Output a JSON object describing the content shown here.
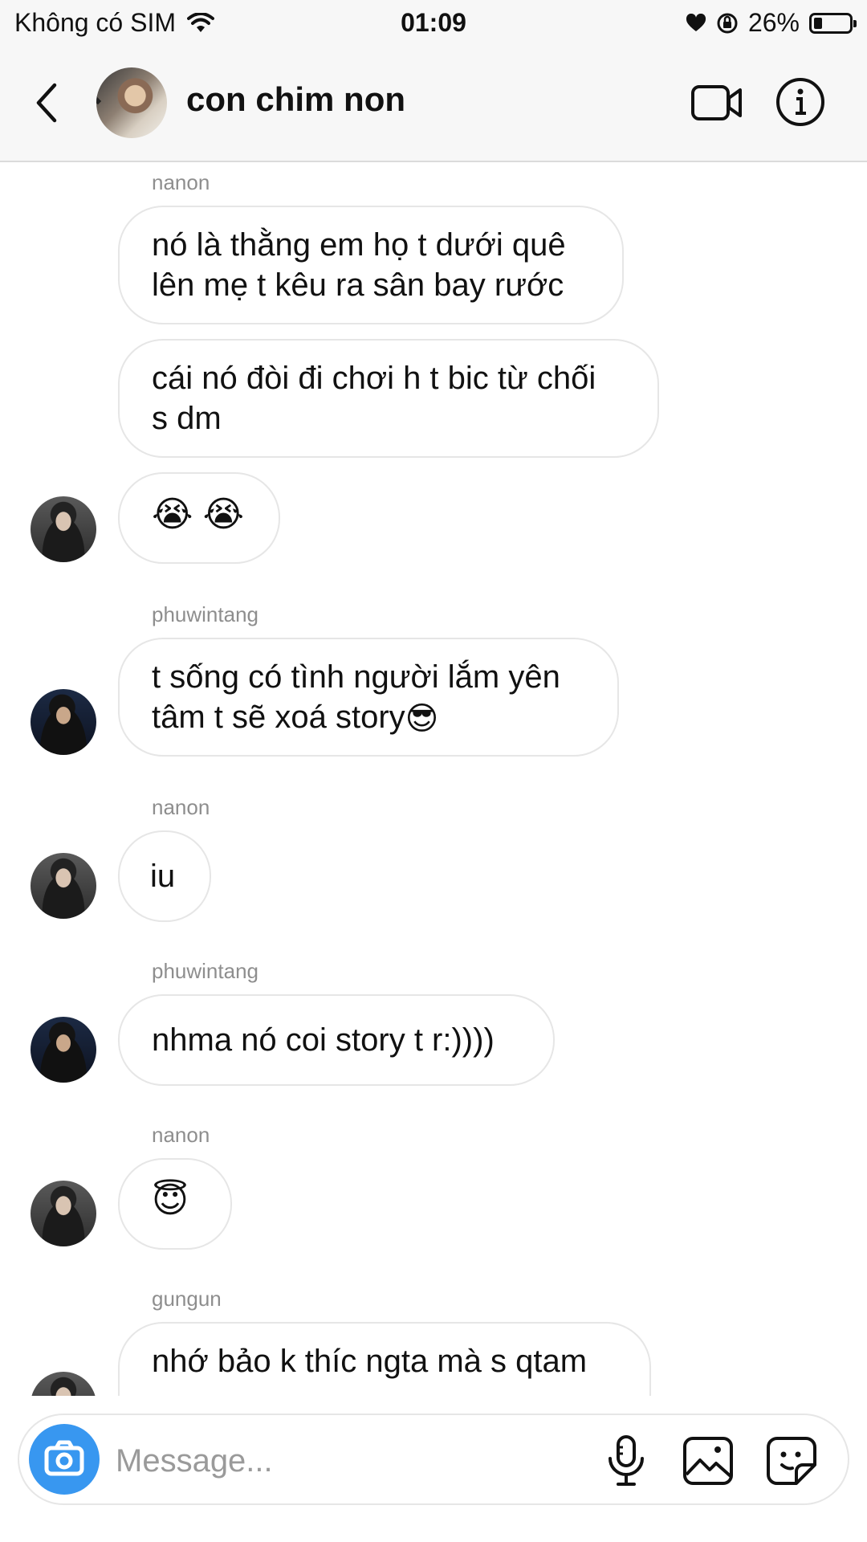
{
  "status_bar": {
    "carrier": "Không có SIM",
    "time": "01:09",
    "battery_percent": "26%"
  },
  "header": {
    "title": "con chim non"
  },
  "messages": [
    {
      "sender": "nanon",
      "lines": [
        "nó là thằng em họ t dưới quê",
        "lên mẹ t kêu ra sân bay rước"
      ]
    },
    {
      "lines": [
        "cái nó đòi đi chơi h t bic từ chối",
        "s dm"
      ]
    },
    {
      "emoji": [
        "😭",
        "😭"
      ]
    },
    {
      "sender": "phuwintang",
      "lines": [
        "t sống có tình người lắm yên",
        "tâm t sẽ xoá story"
      ],
      "trailing_emoji": "😎"
    },
    {
      "sender": "nanon",
      "text": "iu"
    },
    {
      "sender": "phuwintang",
      "text": "nhma nó coi story t r:))))"
    },
    {
      "sender": "nanon",
      "emoji": [
        "😇"
      ]
    },
    {
      "sender": "gungun",
      "lines": [
        "nhớ bảo k thíc ngta mà s qtam"
      ]
    }
  ],
  "composer": {
    "placeholder": "Message..."
  },
  "colors": {
    "accent": "#3897f0",
    "bubble_border": "#e6e6e6",
    "sender_text": "#8e8e8e"
  },
  "icons": [
    "wifi-icon",
    "heart-icon",
    "orientation-lock-icon",
    "battery-icon",
    "back-chevron-icon",
    "video-call-icon",
    "info-icon",
    "camera-icon",
    "microphone-icon",
    "gallery-icon",
    "sticker-icon"
  ]
}
